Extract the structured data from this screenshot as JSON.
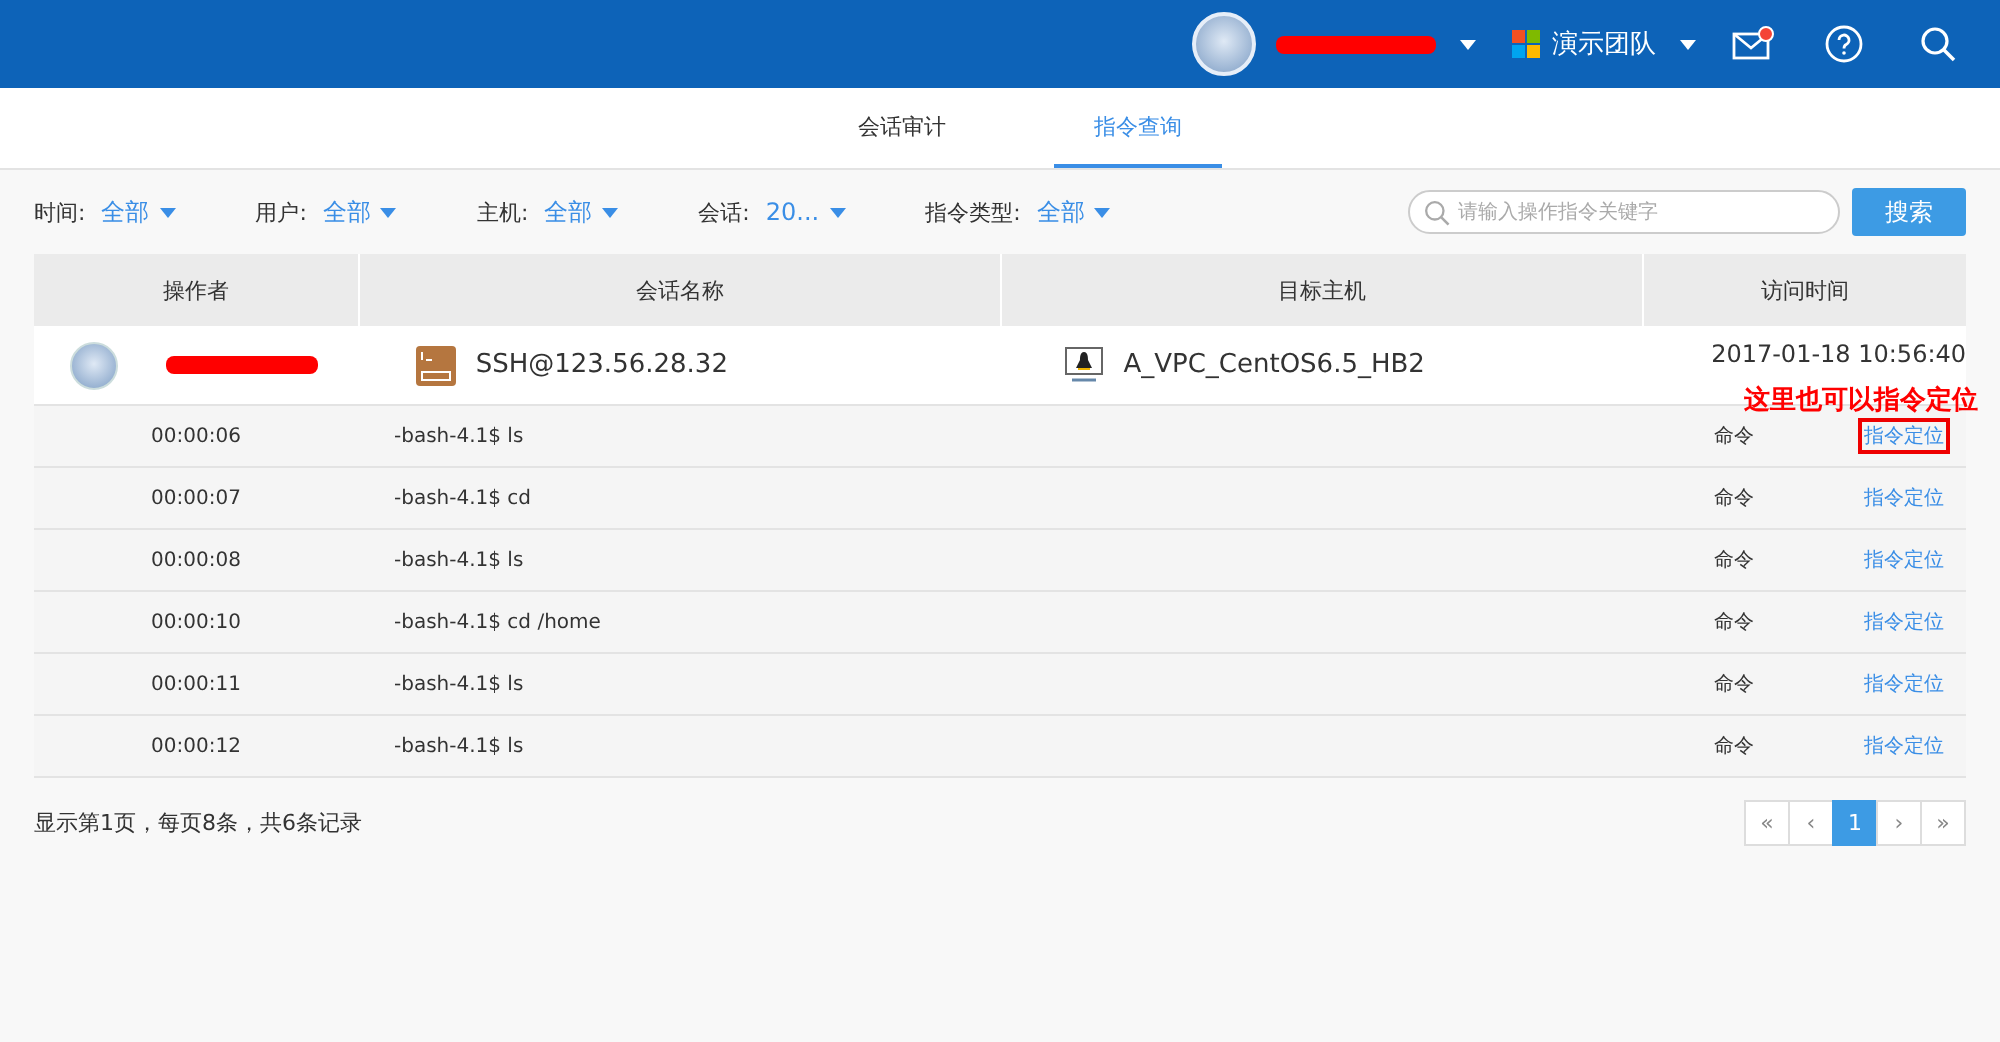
{
  "topbar": {
    "team": "演示团队",
    "mail_unread": true
  },
  "tabs": [
    {
      "label": "会话审计",
      "selected": false
    },
    {
      "label": "指令查询",
      "selected": true
    }
  ],
  "filters": [
    {
      "label": "时间:",
      "value": "全部"
    },
    {
      "label": "用户:",
      "value": "全部"
    },
    {
      "label": "主机:",
      "value": "全部"
    },
    {
      "label": "会话:",
      "value": "20..."
    },
    {
      "label": "指令类型:",
      "value": "全部"
    }
  ],
  "search": {
    "placeholder": "请输入操作指令关键字",
    "button": "搜索"
  },
  "table": {
    "columns": [
      "操作者",
      "会话名称",
      "目标主机",
      "访问时间"
    ],
    "session": {
      "session_name": "SSH@123.56.28.32",
      "host": "A_VPC_CentOS6.5_HB2",
      "time": "2017-01-18  10:56:40"
    },
    "rows": [
      {
        "time": "00:00:06",
        "command": "-bash-4.1$ ls",
        "type": "命令",
        "action": "指令定位",
        "highlighted": true
      },
      {
        "time": "00:00:07",
        "command": "-bash-4.1$ cd",
        "type": "命令",
        "action": "指令定位",
        "highlighted": false
      },
      {
        "time": "00:00:08",
        "command": "-bash-4.1$ ls",
        "type": "命令",
        "action": "指令定位",
        "highlighted": false
      },
      {
        "time": "00:00:10",
        "command": "-bash-4.1$ cd /home",
        "type": "命令",
        "action": "指令定位",
        "highlighted": false
      },
      {
        "time": "00:00:11",
        "command": "-bash-4.1$ ls",
        "type": "命令",
        "action": "指令定位",
        "highlighted": false
      },
      {
        "time": "00:00:12",
        "command": "-bash-4.1$ ls",
        "type": "命令",
        "action": "指令定位",
        "highlighted": false
      }
    ]
  },
  "annotation": "这里也可以指令定位",
  "footer": {
    "summary": "显示第1页，每页8条，共6条记录",
    "pages": [
      {
        "label": "«",
        "selected": false
      },
      {
        "label": "‹",
        "selected": false
      },
      {
        "label": "1",
        "selected": true
      },
      {
        "label": "›",
        "selected": false
      },
      {
        "label": "»",
        "selected": false
      }
    ]
  }
}
